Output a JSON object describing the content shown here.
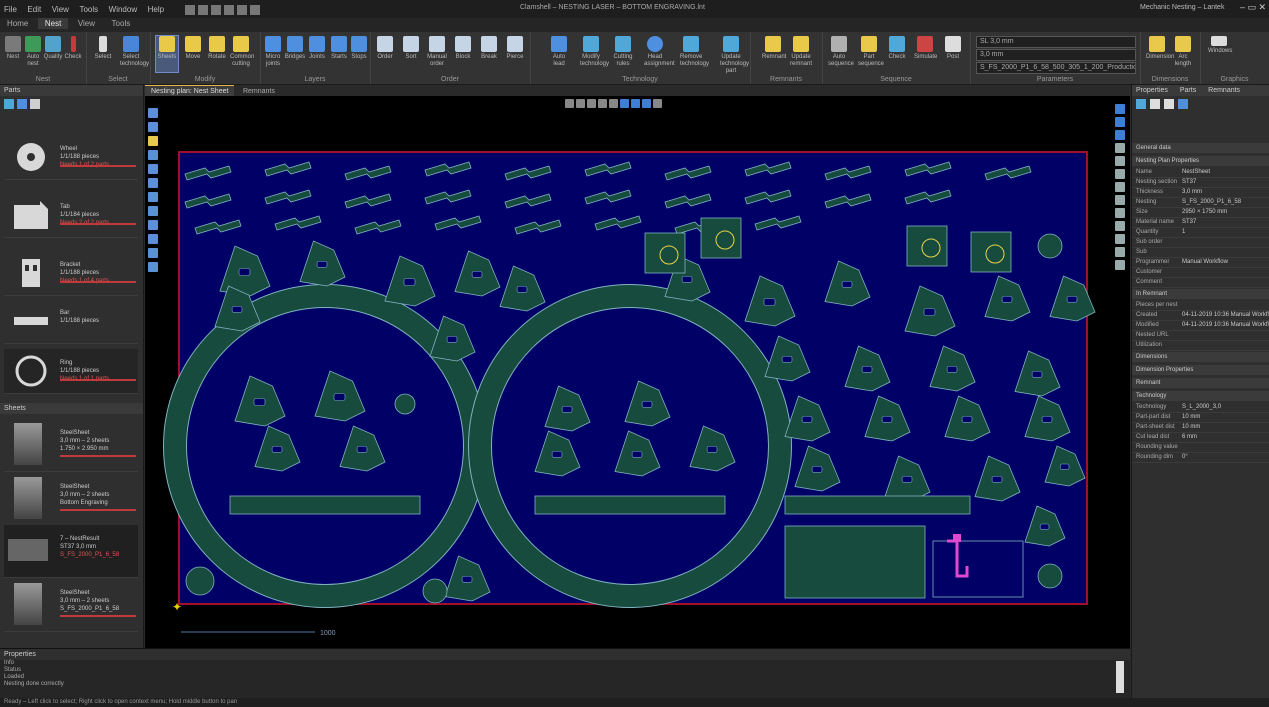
{
  "window": {
    "title": "Clamshell – NESTING LASER – BOTTOM ENGRAVING.lnt",
    "menu": [
      "File",
      "Edit",
      "View",
      "Tools",
      "Window",
      "Help"
    ],
    "user": "Mechanic Nesting – Lantek"
  },
  "ribbon_tabs": [
    "Home",
    "Nest",
    "View",
    "Tools"
  ],
  "ribbon_active_tab": 1,
  "ribbon_groups": [
    {
      "label": "Nest",
      "buttons": [
        "Nest",
        "Auto nest",
        "Quality",
        "Check"
      ]
    },
    {
      "label": "Select",
      "buttons": [
        "Select",
        "Select technology"
      ]
    },
    {
      "label": "Modify",
      "buttons": [
        "Sheets",
        "Move",
        "Rotate",
        "Common cutting"
      ]
    },
    {
      "label": "Layers",
      "buttons": [
        "Micro joints",
        "Bridges",
        "Joints",
        "Starts",
        "Stops"
      ]
    },
    {
      "label": "Order",
      "buttons": [
        "Order",
        "Sort",
        "Manual order",
        "Block",
        "Break",
        "Pierce"
      ]
    },
    {
      "label": "Technology",
      "buttons": [
        "Auto lead",
        "Modify technology",
        "Cutting rules",
        "Head assignment",
        "Remove technology",
        "Update technology part"
      ]
    },
    {
      "label": "Remnants",
      "buttons": [
        "Remnant",
        "Update remnant"
      ]
    },
    {
      "label": "Sequence",
      "buttons": [
        "Auto sequence",
        "Part sequence",
        "Check",
        "Simulate",
        "Post"
      ]
    },
    {
      "label": "Parameters",
      "buttons": []
    },
    {
      "label": "Dimensions",
      "buttons": [
        "Dimension",
        "Arc length"
      ]
    },
    {
      "label": "Graphics",
      "buttons": [
        "Windows"
      ]
    }
  ],
  "ribbon_combos": [
    "SL 3,0 mm",
    "3,0 mm",
    "S_FS_2000_P1_6_58_500_305_1_200_Production"
  ],
  "left_panel": {
    "title": "Parts",
    "parts": [
      {
        "name": "Wheel",
        "info": "1/1/188 pieces",
        "status": "Needs 1 of 2 parts"
      },
      {
        "name": "Tab",
        "info": "1/1/184 pieces",
        "status": "Needs 2 of 2 parts"
      },
      {
        "name": "Bracket",
        "info": "1/1/188 pieces",
        "status": "Needs 1 of 4 parts"
      },
      {
        "name": "Bar",
        "info": "1/1/188 pieces",
        "status": ""
      },
      {
        "name": "Ring",
        "info": "1/1/188 pieces",
        "status": "Needs 1 of 1 parts"
      }
    ],
    "sheets_title": "Sheets",
    "sheets": [
      {
        "name": "SteelSheet",
        "info": "3,0 mm – 2 sheets",
        "dims": "1.750 × 2.950 mm"
      },
      {
        "name": "SteelSheet",
        "info": "3,0 mm – 2 sheets",
        "dims": "Bottom Engraving"
      },
      {
        "name": "7 – NestResult",
        "info": "ST37 3,0 mm",
        "dims": "S_FS_2000_P1_6_58"
      },
      {
        "name": "SteelSheet",
        "info": "3,0 mm – 2 sheets",
        "dims": "S_FS_2000_P1_6_58"
      }
    ]
  },
  "doc_tabs": [
    "Nesting plan: Nest Sheet",
    "Remnants"
  ],
  "canvas": {
    "scale_label": "1000",
    "sheet_fill": "#000066",
    "part_fill": "#174b3e",
    "part_stroke": "#7fb3c0",
    "border": "#a0102a",
    "highlight": "#e048d0",
    "label_color": "#e8d24a"
  },
  "right_panel": {
    "title": "Properties",
    "tabs": [
      "Properties",
      "Parts",
      "Remnants"
    ],
    "sections": [
      {
        "title": "General data",
        "rows": []
      },
      {
        "title": "Nesting Plan Properties",
        "rows": [
          {
            "k": "Name",
            "v": "NestSheet"
          },
          {
            "k": "Nesting section",
            "v": "ST37"
          },
          {
            "k": "Thickness",
            "v": "3,0 mm"
          },
          {
            "k": "Nesting",
            "v": "S_FS_2000_P1_6_58"
          },
          {
            "k": "Size",
            "v": "2950 × 1750 mm"
          },
          {
            "k": "Material name",
            "v": "ST37"
          },
          {
            "k": "Quantity",
            "v": "1"
          },
          {
            "k": "Sub order",
            "v": ""
          },
          {
            "k": "Sub",
            "v": ""
          },
          {
            "k": "Programmer",
            "v": "Manual Workflow"
          },
          {
            "k": "Customer",
            "v": ""
          },
          {
            "k": "Comment",
            "v": ""
          }
        ]
      },
      {
        "title": "In Remnant",
        "rows": [
          {
            "k": "Pieces per nest",
            "v": ""
          },
          {
            "k": "Created",
            "v": "04-11-2019 10:36 Manual Workflow"
          },
          {
            "k": "Modified",
            "v": "04-11-2019 10:36 Manual Workflow"
          },
          {
            "k": "Nested URL",
            "v": ""
          },
          {
            "k": "Utilization",
            "v": ""
          }
        ]
      },
      {
        "title": "Dimensions",
        "rows": []
      },
      {
        "title": "Dimension Properties",
        "rows": []
      },
      {
        "title": "Remnant",
        "rows": []
      },
      {
        "title": "Technology",
        "rows": [
          {
            "k": "Technology",
            "v": "S_L_2000_3,0"
          },
          {
            "k": "Part-part dist",
            "v": "10 mm"
          },
          {
            "k": "Part-sheet dist",
            "v": "10 mm"
          },
          {
            "k": "Cut lead dist",
            "v": "6 mm"
          },
          {
            "k": "Rounding value",
            "v": ""
          },
          {
            "k": "Rounding dim",
            "v": "0°"
          }
        ]
      }
    ]
  },
  "bottom_panel": {
    "title": "Properties",
    "lines": [
      "Info",
      "Status",
      "Loaded",
      "Nesting done correctly"
    ]
  },
  "status": "Ready – Left click to select; Right click to open context menu; Hold middle button to pan"
}
